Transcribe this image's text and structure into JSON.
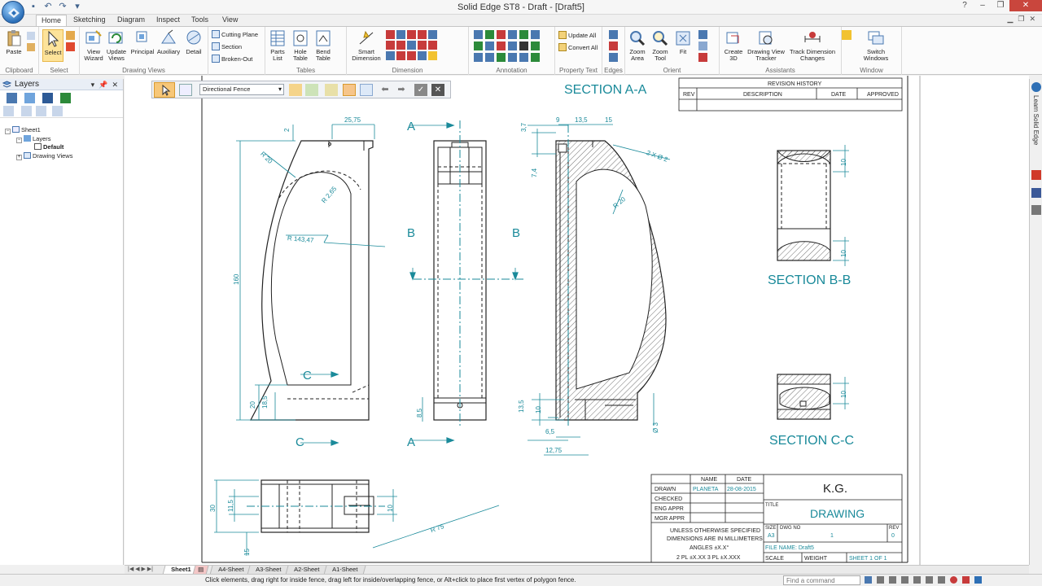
{
  "window": {
    "title": "Solid Edge ST8 - Draft - [Draft5]"
  },
  "tabs": [
    "Home",
    "Sketching",
    "Diagram",
    "Inspect",
    "Tools",
    "View"
  ],
  "ribbon": {
    "groups": {
      "clipboard": "Clipboard",
      "select": "Select",
      "drawing_views": "Drawing Views",
      "tables": "Tables",
      "dimension": "Dimension",
      "annotation": "Annotation",
      "property_text": "Property Text",
      "edges": "Edges",
      "orient": "Orient",
      "assistants": "Assistants",
      "window": "Window"
    },
    "buttons": {
      "paste": "Paste",
      "select": "Select",
      "view_wizard_1": "View",
      "view_wizard_2": "Wizard",
      "update_views_1": "Update",
      "update_views_2": "Views",
      "principal": "Principal",
      "auxiliary": "Auxiliary",
      "detail": "Detail",
      "cutting_plane": "Cutting Plane",
      "section": "Section",
      "broken_out": "Broken-Out",
      "parts_list_1": "Parts",
      "parts_list_2": "List",
      "hole_table_1": "Hole",
      "hole_table_2": "Table",
      "bend_table_1": "Bend",
      "bend_table_2": "Table",
      "smart_dimension_1": "Smart",
      "smart_dimension_2": "Dimension",
      "update_all": "Update All",
      "convert_all": "Convert All",
      "zoom_area_1": "Zoom",
      "zoom_area_2": "Area",
      "zoom_tool_1": "Zoom",
      "zoom_tool_2": "Tool",
      "fit": "Fit",
      "create_3d_1": "Create",
      "create_3d_2": "3D",
      "dv_tracker_1": "Drawing View",
      "dv_tracker_2": "Tracker",
      "track_dim_1": "Track Dimension",
      "track_dim_2": "Changes",
      "switch_windows_1": "Switch",
      "switch_windows_2": "Windows"
    }
  },
  "layers_panel": {
    "title": "Layers",
    "tree": {
      "sheet": "Sheet1",
      "layers": "Layers",
      "default": "Default",
      "drawing_views": "Drawing Views"
    }
  },
  "fence_toolbar": {
    "mode": "Directional Fence"
  },
  "right_strip": {
    "learn": "Learn Solid Edge"
  },
  "drawing": {
    "section_aa": "SECTION A-A",
    "section_bb": "SECTION B-B",
    "section_cc": "SECTION C-C",
    "labels": {
      "A": "A",
      "B": "B",
      "C": "C"
    },
    "dims": {
      "d2": "2",
      "d2575": "25,75",
      "r20": "R 20",
      "r265": "R 2,65",
      "r1437": "R 143,47",
      "d160": "160",
      "d20": "20",
      "d185": "18,5",
      "d85": "8,5",
      "d37": "3,7",
      "d9": "9",
      "d135": "13,5",
      "d15": "15",
      "d2x2": "2 X  Ø 2",
      "d74": "7,4",
      "r20b": "R 20",
      "d135b": "13,5",
      "d10": "10",
      "d65": "6,5",
      "d1275": "12,75",
      "dd3": "Ø 3",
      "bb10a": "10",
      "bb10b": "10",
      "cc10": "10",
      "pv30": "30",
      "pv115": "11,5",
      "pv10": "10",
      "pv15": "15",
      "pvr75": "R 75"
    },
    "revision": {
      "title": "REVISION HISTORY",
      "cols": [
        "REV",
        "DESCRIPTION",
        "DATE",
        "APPROVED"
      ]
    },
    "titleblock": {
      "name_h": "NAME",
      "date_h": "DATE",
      "drawn": "DRAWN",
      "drawn_name": "PLANETA",
      "drawn_date": "28-08-2015",
      "checked": "CHECKED",
      "eng_appr": "ENG APPR",
      "mgr_appr": "MGR APPR",
      "note1": "UNLESS OTHERWISE SPECIFIED",
      "note2": "DIMENSIONS ARE IN MILLIMETERS",
      "note3": "ANGLES ±X.X°",
      "note4": "2 PL ±X.XX 3 PL ±X.XXX",
      "company": "K.G.",
      "title_h": "TITLE",
      "title": "DRAWING",
      "size_h": "SIZE",
      "size": "A3",
      "dwg_h": "DWG NO",
      "dwg": "1",
      "rev_h": "REV",
      "rev": "0",
      "file": "FILE NAME: Draft5",
      "scale": "SCALE",
      "weight": "WEIGHT",
      "sheet": "SHEET 1 OF 1"
    }
  },
  "sheet_tabs": [
    "Sheet1",
    "A4-Sheet",
    "A3-Sheet",
    "A2-Sheet",
    "A1-Sheet"
  ],
  "status": {
    "message": "Click elements, drag right for inside fence, drag left for inside/overlapping fence, or Alt+click to place first vertex of polygon fence.",
    "command_placeholder": "Find a command"
  }
}
